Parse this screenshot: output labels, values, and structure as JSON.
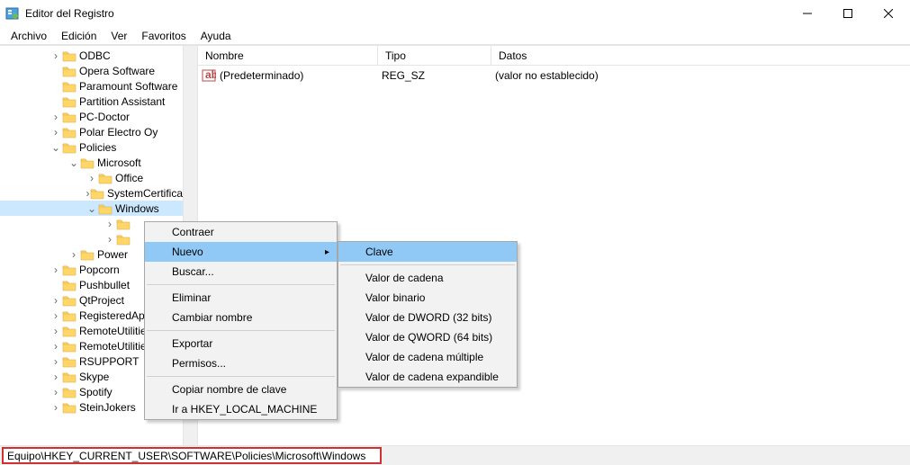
{
  "window": {
    "title": "Editor del Registro"
  },
  "menu": {
    "items": [
      "Archivo",
      "Edición",
      "Ver",
      "Favoritos",
      "Ayuda"
    ]
  },
  "tree": {
    "items": [
      {
        "indent": 55,
        "expander": "›",
        "label": "ODBC"
      },
      {
        "indent": 55,
        "expander": "",
        "label": "Opera Software"
      },
      {
        "indent": 55,
        "expander": "",
        "label": "Paramount Software"
      },
      {
        "indent": 55,
        "expander": "",
        "label": "Partition Assistant"
      },
      {
        "indent": 55,
        "expander": "›",
        "label": "PC-Doctor"
      },
      {
        "indent": 55,
        "expander": "›",
        "label": "Polar Electro Oy"
      },
      {
        "indent": 55,
        "expander": "v",
        "label": "Policies"
      },
      {
        "indent": 75,
        "expander": "v",
        "label": "Microsoft"
      },
      {
        "indent": 95,
        "expander": "›",
        "label": "Office"
      },
      {
        "indent": 95,
        "expander": "›",
        "label": "SystemCertificates"
      },
      {
        "indent": 95,
        "expander": "v",
        "label": "Windows",
        "selected": true
      },
      {
        "indent": 115,
        "expander": "›",
        "label": ""
      },
      {
        "indent": 115,
        "expander": "›",
        "label": ""
      },
      {
        "indent": 75,
        "expander": "›",
        "label": "Power"
      },
      {
        "indent": 55,
        "expander": "›",
        "label": "Popcorn"
      },
      {
        "indent": 55,
        "expander": "",
        "label": "Pushbullet"
      },
      {
        "indent": 55,
        "expander": "›",
        "label": "QtProject"
      },
      {
        "indent": 55,
        "expander": "›",
        "label": "RegisteredApplications"
      },
      {
        "indent": 55,
        "expander": "›",
        "label": "RemoteUtilities"
      },
      {
        "indent": 55,
        "expander": "›",
        "label": "RemoteUtilities"
      },
      {
        "indent": 55,
        "expander": "›",
        "label": "RSUPPORT"
      },
      {
        "indent": 55,
        "expander": "›",
        "label": "Skype"
      },
      {
        "indent": 55,
        "expander": "›",
        "label": "Spotify"
      },
      {
        "indent": 55,
        "expander": "›",
        "label": "SteinJokers"
      }
    ]
  },
  "values": {
    "columns": {
      "name": "Nombre",
      "type": "Tipo",
      "data": "Datos"
    },
    "rows": [
      {
        "name": "(Predeterminado)",
        "type": "REG_SZ",
        "data": "(valor no establecido)"
      }
    ]
  },
  "context_menu": {
    "items1": [
      {
        "label": "Contraer"
      },
      {
        "label": "Nuevo",
        "submenu": true,
        "highlight": true
      },
      {
        "label": "Buscar..."
      },
      {
        "sep": true
      },
      {
        "label": "Eliminar"
      },
      {
        "label": "Cambiar nombre"
      },
      {
        "sep": true
      },
      {
        "label": "Exportar"
      },
      {
        "label": "Permisos..."
      },
      {
        "sep": true
      },
      {
        "label": "Copiar nombre de clave"
      },
      {
        "label": "Ir a HKEY_LOCAL_MACHINE"
      }
    ],
    "items2": [
      {
        "label": "Clave",
        "highlight": true
      },
      {
        "sep": true
      },
      {
        "label": "Valor de cadena"
      },
      {
        "label": "Valor binario"
      },
      {
        "label": "Valor de DWORD (32 bits)"
      },
      {
        "label": "Valor de QWORD (64 bits)"
      },
      {
        "label": "Valor de cadena múltiple"
      },
      {
        "label": "Valor de cadena expandible"
      }
    ]
  },
  "status": {
    "path": "Equipo\\HKEY_CURRENT_USER\\SOFTWARE\\Policies\\Microsoft\\Windows"
  }
}
